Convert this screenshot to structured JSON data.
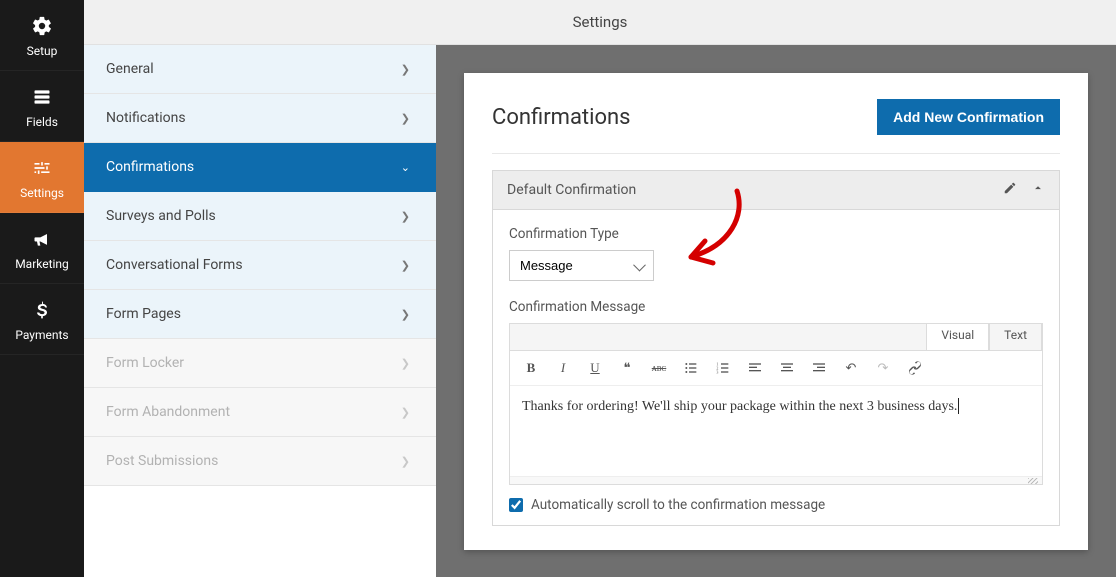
{
  "topbar": {
    "title": "Settings"
  },
  "vnav": {
    "items": [
      {
        "label": "Setup"
      },
      {
        "label": "Fields"
      },
      {
        "label": "Settings"
      },
      {
        "label": "Marketing"
      },
      {
        "label": "Payments"
      }
    ]
  },
  "sidepanel": {
    "items": [
      {
        "label": "General"
      },
      {
        "label": "Notifications"
      },
      {
        "label": "Confirmations"
      },
      {
        "label": "Surveys and Polls"
      },
      {
        "label": "Conversational Forms"
      },
      {
        "label": "Form Pages"
      },
      {
        "label": "Form Locker"
      },
      {
        "label": "Form Abandonment"
      },
      {
        "label": "Post Submissions"
      }
    ]
  },
  "card": {
    "title": "Confirmations",
    "add_button": "Add New Confirmation"
  },
  "panel": {
    "title": "Default Confirmation",
    "type_label": "Confirmation Type",
    "type_value": "Message",
    "msg_label": "Confirmation Message",
    "editor_tabs": {
      "visual": "Visual",
      "text": "Text"
    },
    "content": "Thanks for ordering! We'll ship your package within the next 3 business days.",
    "scroll_label": "Automatically scroll to the confirmation message",
    "scroll_checked": true
  },
  "toolbar_icons": {
    "bold": "B",
    "italic": "I",
    "underline": "U",
    "quote": "❝",
    "strike": "ᴀʙᴄ",
    "ul": "≣",
    "ol": "≣",
    "al": "≡",
    "ac": "≡",
    "ar": "≡",
    "undo": "↶",
    "redo": "↷",
    "link": "🔗"
  },
  "colors": {
    "accent": "#e27730",
    "primary": "#0e6cad",
    "annotation": "#d40000"
  }
}
